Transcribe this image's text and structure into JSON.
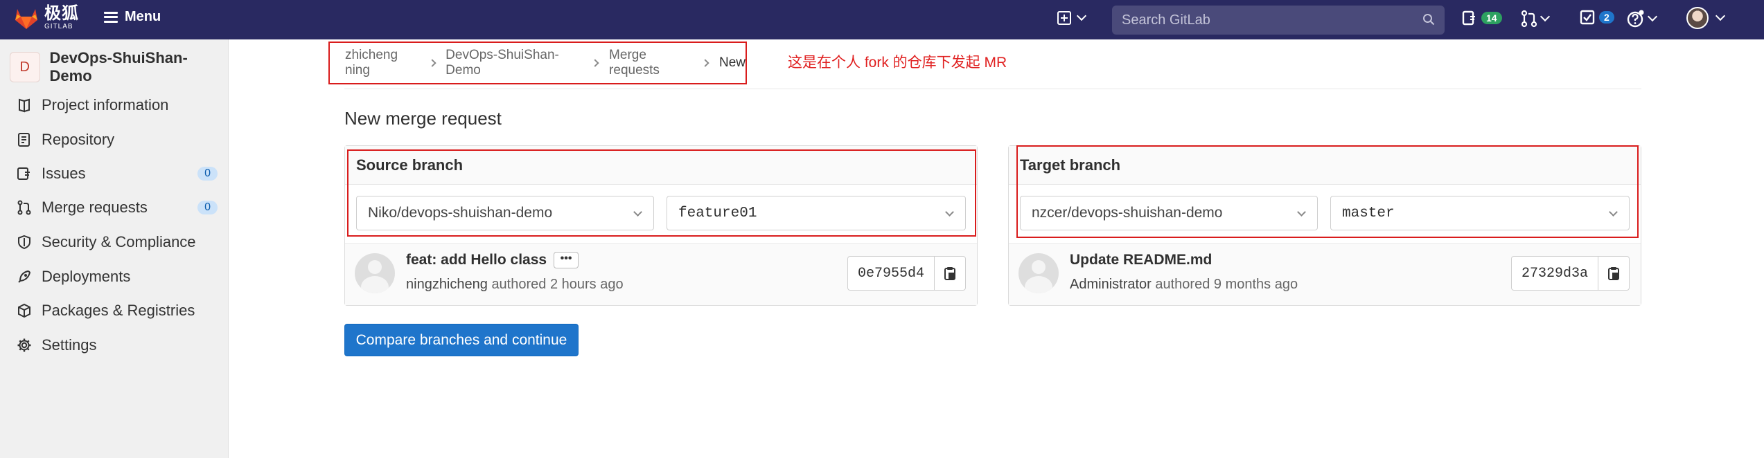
{
  "topbar": {
    "logo_cn": "极狐",
    "logo_en": "GITLAB",
    "menu_label": "Menu",
    "search_placeholder": "Search GitLab",
    "issues_count": "14",
    "todos_count": "2",
    "bg_color": "#292961"
  },
  "sidebar": {
    "project_initial": "D",
    "project_name": "DevOps-ShuiShan-Demo",
    "items": [
      {
        "label": "Project information",
        "icon": "project-icon"
      },
      {
        "label": "Repository",
        "icon": "repository-icon"
      },
      {
        "label": "Issues",
        "icon": "issues-icon",
        "count": "0"
      },
      {
        "label": "Merge requests",
        "icon": "merge-request-icon",
        "count": "0"
      },
      {
        "label": "Security & Compliance",
        "icon": "shield-icon"
      },
      {
        "label": "Deployments",
        "icon": "rocket-icon"
      },
      {
        "label": "Packages & Registries",
        "icon": "package-icon"
      },
      {
        "label": "Settings",
        "icon": "gear-icon"
      }
    ]
  },
  "breadcrumb": {
    "items": [
      "zhicheng ning",
      "DevOps-ShuiShan-Demo",
      "Merge requests",
      "New"
    ]
  },
  "annotation": "这是在个人 fork 的仓库下发起 MR",
  "page_title": "New merge request",
  "source": {
    "heading": "Source branch",
    "project": "Niko/devops-shuishan-demo",
    "branch": "feature01",
    "commit_title": "feat: add Hello class",
    "commit_author": "ningzhicheng",
    "commit_time": "authored 2 hours ago",
    "sha": "0e7955d4"
  },
  "target": {
    "heading": "Target branch",
    "project": "nzcer/devops-shuishan-demo",
    "branch": "master",
    "commit_title": "Update README.md",
    "commit_author": "Administrator",
    "commit_time": "authored 9 months ago",
    "sha": "27329d3a"
  },
  "compare_button": "Compare branches and continue",
  "colors": {
    "accent": "#1f75cb",
    "annotation_red": "#d91c1c"
  }
}
